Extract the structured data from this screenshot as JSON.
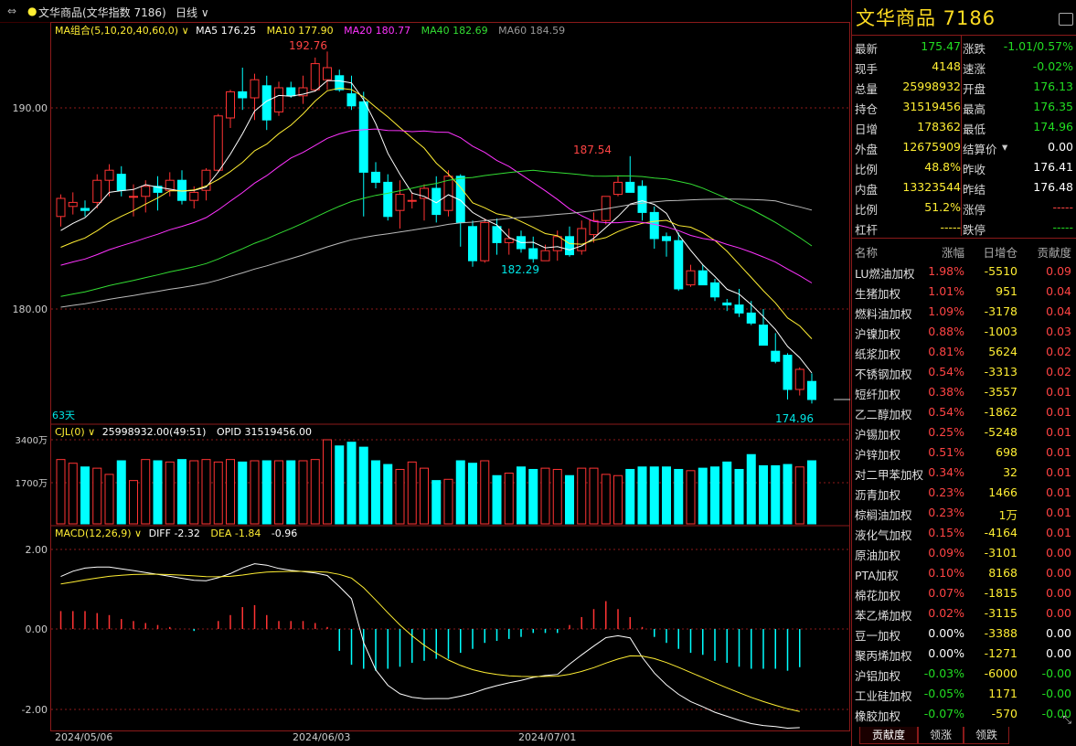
{
  "header": {
    "menu_icon": "link-icon",
    "instrument": "文华商品(文华指数 7186)",
    "period": "日线"
  },
  "main_chart": {
    "indicator_label": "MA组合(5,10,20,40,60,0)",
    "ma5": "MA5 176.25",
    "ma10": "MA10 177.90",
    "ma20": "MA20 180.77",
    "ma40": "MA40 182.69",
    "ma60": "MA60 184.59",
    "high_label": "192.76",
    "mid_high_label": "187.54",
    "mid_low_label": "182.29",
    "low_label": "174.96",
    "days_label": "63天",
    "y_ticks": [
      "190.00",
      "180.00"
    ],
    "colors": {
      "ma5": "#ffffff",
      "ma10": "#ffee33",
      "ma20": "#ff33ff",
      "ma40": "#33dd33",
      "ma60": "#bbbbbb",
      "up": "#ff3333",
      "down": "#00ffff"
    }
  },
  "volume_chart": {
    "label": "CJL(0)",
    "value": "25998932.00(49:51)",
    "opid": "OPID 31519456.00",
    "y_ticks": [
      "3400万",
      "1700万"
    ]
  },
  "macd_chart": {
    "label": "MACD(12,26,9)",
    "diff": "DIFF -2.32",
    "dea": "DEA -1.84",
    "macd": "-0.96",
    "y_ticks": [
      "2.00",
      "0.00",
      "-2.00"
    ]
  },
  "x_axis": [
    "2024/05/06",
    "2024/06/03",
    "2024/07/01"
  ],
  "chart_data": {
    "type": "candlestick",
    "dates": [
      "2024/05/06",
      "2024/06/03",
      "2024/07/01"
    ],
    "ohlc": [
      [
        184.6,
        185.7,
        184.1,
        185.5
      ],
      [
        185.1,
        185.8,
        184.7,
        185.3
      ],
      [
        185.0,
        185.4,
        184.6,
        184.9
      ],
      [
        185.3,
        186.7,
        185.0,
        186.4
      ],
      [
        186.4,
        187.2,
        185.6,
        186.9
      ],
      [
        186.7,
        187.1,
        185.6,
        185.9
      ],
      [
        185.6,
        186.2,
        184.6,
        185.6
      ],
      [
        185.6,
        186.4,
        184.8,
        186.1
      ],
      [
        186.1,
        186.6,
        184.9,
        185.8
      ],
      [
        185.9,
        186.8,
        185.6,
        186.4
      ],
      [
        186.4,
        186.9,
        185.2,
        185.4
      ],
      [
        185.4,
        186.1,
        185.0,
        185.8
      ],
      [
        185.9,
        187.0,
        185.4,
        186.9
      ],
      [
        186.9,
        189.7,
        186.8,
        189.6
      ],
      [
        189.5,
        190.9,
        189.0,
        190.8
      ],
      [
        190.8,
        192.0,
        189.9,
        190.5
      ],
      [
        190.5,
        191.7,
        189.4,
        191.4
      ],
      [
        191.1,
        191.6,
        188.9,
        189.4
      ],
      [
        189.8,
        191.3,
        189.6,
        191.0
      ],
      [
        191.0,
        191.3,
        190.5,
        190.6
      ],
      [
        190.6,
        191.6,
        190.2,
        191.0
      ],
      [
        190.9,
        192.5,
        190.8,
        192.2
      ],
      [
        191.4,
        192.8,
        190.9,
        192.0
      ],
      [
        191.6,
        191.9,
        190.8,
        190.9
      ],
      [
        190.7,
        191.6,
        189.9,
        190.1
      ],
      [
        190.3,
        190.8,
        184.6,
        186.8
      ],
      [
        186.8,
        187.3,
        186.0,
        186.3
      ],
      [
        186.3,
        186.7,
        184.4,
        184.6
      ],
      [
        184.9,
        186.4,
        184.0,
        185.7
      ],
      [
        185.4,
        185.8,
        185.0,
        185.4
      ],
      [
        185.5,
        186.2,
        184.4,
        186.0
      ],
      [
        186.0,
        186.6,
        184.3,
        184.7
      ],
      [
        184.9,
        186.9,
        184.6,
        186.6
      ],
      [
        186.6,
        186.7,
        183.1,
        184.3
      ],
      [
        184.1,
        184.4,
        182.1,
        182.4
      ],
      [
        182.4,
        184.5,
        182.3,
        184.3
      ],
      [
        184.1,
        184.5,
        182.7,
        183.3
      ],
      [
        183.3,
        184.0,
        182.7,
        183.5
      ],
      [
        183.6,
        183.9,
        182.8,
        183.0
      ],
      [
        183.0,
        183.6,
        182.3,
        182.5
      ],
      [
        182.4,
        183.2,
        182.4,
        182.9
      ],
      [
        182.9,
        183.9,
        182.4,
        183.6
      ],
      [
        183.6,
        184.1,
        182.6,
        182.7
      ],
      [
        182.9,
        184.4,
        182.7,
        184.0
      ],
      [
        183.7,
        184.8,
        183.3,
        184.4
      ],
      [
        184.4,
        185.6,
        184.2,
        185.6
      ],
      [
        185.7,
        186.6,
        185.6,
        186.3
      ],
      [
        186.3,
        187.6,
        186.1,
        185.8
      ],
      [
        186.1,
        186.4,
        184.4,
        184.8
      ],
      [
        184.8,
        185.1,
        183.0,
        183.5
      ],
      [
        183.6,
        183.8,
        182.6,
        183.4
      ],
      [
        183.4,
        183.8,
        180.9,
        181.0
      ],
      [
        181.2,
        182.2,
        181.1,
        181.9
      ],
      [
        181.9,
        182.2,
        181.2,
        181.2
      ],
      [
        181.3,
        181.5,
        180.4,
        180.6
      ],
      [
        180.3,
        180.5,
        179.9,
        180.2
      ],
      [
        180.2,
        181.0,
        179.6,
        179.8
      ],
      [
        179.8,
        180.4,
        179.2,
        179.3
      ],
      [
        179.2,
        180.0,
        178.2,
        178.2
      ],
      [
        177.9,
        178.8,
        177.3,
        177.4
      ],
      [
        177.7,
        177.8,
        175.5,
        176.0
      ],
      [
        176.0,
        177.1,
        175.7,
        177.0
      ],
      [
        176.4,
        176.8,
        175.3,
        175.5
      ]
    ],
    "volume_units": "万",
    "volume": [
      2600,
      2450,
      2300,
      2250,
      2000,
      2550,
      1750,
      2600,
      2550,
      2500,
      2600,
      2550,
      2600,
      2500,
      2600,
      2500,
      2550,
      2550,
      2550,
      2550,
      2550,
      2600,
      3400,
      3150,
      3300,
      3100,
      2550,
      2400,
      2200,
      2500,
      2250,
      1750,
      1800,
      2550,
      2450,
      2550,
      1950,
      2050,
      2300,
      2200,
      2250,
      2200,
      1950,
      2250,
      2250,
      2000,
      1950,
      2200,
      2300,
      2300,
      2300,
      2200,
      2150,
      2250,
      2300,
      2500,
      2200,
      2800,
      2350,
      2350,
      2400,
      2300,
      2550
    ],
    "macd_hist": [
      0.45,
      0.45,
      0.45,
      0.4,
      0.35,
      0.25,
      0.2,
      0.15,
      0.1,
      0.05,
      0.0,
      -0.05,
      0.0,
      0.2,
      0.35,
      0.55,
      0.6,
      0.35,
      0.2,
      0.2,
      0.2,
      0.15,
      0.05,
      -0.55,
      -0.9,
      -1.0,
      -1.05,
      -1.0,
      -0.95,
      -0.85,
      -0.8,
      -0.75,
      -0.75,
      -0.6,
      -0.5,
      -0.35,
      -0.3,
      -0.25,
      -0.2,
      -0.1,
      -0.1,
      -0.1,
      0.1,
      0.3,
      0.5,
      0.7,
      0.5,
      0.3,
      0.05,
      -0.2,
      -0.35,
      -0.5,
      -0.6,
      -0.65,
      -0.8,
      -0.85,
      -0.95,
      -1.0,
      -1.0,
      -1.0,
      -1.05,
      -0.96
    ]
  },
  "quote": {
    "title": "文华商品  7186",
    "rows": [
      {
        "l1": "最新",
        "v1": "175.47",
        "c1": "green",
        "l2": "涨跌",
        "v2": "-1.01/0.57%",
        "c2": "green"
      },
      {
        "l1": "现手",
        "v1": "4148",
        "c1": "yellow",
        "l2": "速涨",
        "v2": "-0.02%",
        "c2": "green"
      },
      {
        "l1": "总量",
        "v1": "25998932",
        "c1": "yellow",
        "l2": "开盘",
        "v2": "176.13",
        "c2": "green"
      },
      {
        "l1": "持仓",
        "v1": "31519456",
        "c1": "yellow",
        "l2": "最高",
        "v2": "176.35",
        "c2": "green"
      },
      {
        "l1": "日增",
        "v1": "178362",
        "c1": "yellow",
        "l2": "最低",
        "v2": "174.96",
        "c2": "green"
      },
      {
        "l1": "外盘",
        "v1": "12675909",
        "c1": "yellow",
        "l2": "结算价",
        "v2": "0.00",
        "c2": "white"
      },
      {
        "l1": "比例",
        "v1": "48.8%",
        "c1": "yellow",
        "l2": "昨收",
        "v2": "176.41",
        "c2": "white"
      },
      {
        "l1": "内盘",
        "v1": "13323544",
        "c1": "yellow",
        "l2": "昨结",
        "v2": "176.48",
        "c2": "white"
      },
      {
        "l1": "比例",
        "v1": "51.2%",
        "c1": "yellow",
        "l2": "涨停",
        "v2": "-----",
        "c2": "red"
      },
      {
        "l1": "杠杆",
        "v1": "-----",
        "c1": "yellow",
        "l2": "跌停",
        "v2": "-----",
        "c2": "green"
      }
    ]
  },
  "contrib": {
    "headers": [
      "名称",
      "涨幅",
      "日增仓",
      "贡献度"
    ],
    "rows": [
      {
        "n": "LU燃油加权",
        "p": "1.98%",
        "i": "-5510",
        "c": "0.09",
        "pc": "red",
        "cc": "red"
      },
      {
        "n": "生猪加权",
        "p": "1.01%",
        "i": "951",
        "c": "0.04",
        "pc": "red",
        "cc": "red"
      },
      {
        "n": "燃料油加权",
        "p": "1.09%",
        "i": "-3178",
        "c": "0.04",
        "pc": "red",
        "cc": "red"
      },
      {
        "n": "沪镍加权",
        "p": "0.88%",
        "i": "-1003",
        "c": "0.03",
        "pc": "red",
        "cc": "red"
      },
      {
        "n": "纸浆加权",
        "p": "0.81%",
        "i": "5624",
        "c": "0.02",
        "pc": "red",
        "cc": "red"
      },
      {
        "n": "不锈钢加权",
        "p": "0.54%",
        "i": "-3313",
        "c": "0.02",
        "pc": "red",
        "cc": "red"
      },
      {
        "n": "短纤加权",
        "p": "0.38%",
        "i": "-3557",
        "c": "0.01",
        "pc": "red",
        "cc": "red"
      },
      {
        "n": "乙二醇加权",
        "p": "0.54%",
        "i": "-1862",
        "c": "0.01",
        "pc": "red",
        "cc": "red"
      },
      {
        "n": "沪锡加权",
        "p": "0.25%",
        "i": "-5248",
        "c": "0.01",
        "pc": "red",
        "cc": "red"
      },
      {
        "n": "沪锌加权",
        "p": "0.51%",
        "i": "698",
        "c": "0.01",
        "pc": "red",
        "cc": "red"
      },
      {
        "n": "对二甲苯加权",
        "p": "0.34%",
        "i": "32",
        "c": "0.01",
        "pc": "red",
        "cc": "red"
      },
      {
        "n": "沥青加权",
        "p": "0.23%",
        "i": "1466",
        "c": "0.01",
        "pc": "red",
        "cc": "red"
      },
      {
        "n": "棕榈油加权",
        "p": "0.23%",
        "i": "1万",
        "c": "0.01",
        "pc": "red",
        "cc": "red"
      },
      {
        "n": "液化气加权",
        "p": "0.15%",
        "i": "-4164",
        "c": "0.01",
        "pc": "red",
        "cc": "red"
      },
      {
        "n": "原油加权",
        "p": "0.09%",
        "i": "-3101",
        "c": "0.00",
        "pc": "red",
        "cc": "red"
      },
      {
        "n": "PTA加权",
        "p": "0.10%",
        "i": "8168",
        "c": "0.00",
        "pc": "red",
        "cc": "red"
      },
      {
        "n": "棉花加权",
        "p": "0.07%",
        "i": "-1815",
        "c": "0.00",
        "pc": "red",
        "cc": "red"
      },
      {
        "n": "苯乙烯加权",
        "p": "0.02%",
        "i": "-3115",
        "c": "0.00",
        "pc": "red",
        "cc": "red"
      },
      {
        "n": "豆一加权",
        "p": "0.00%",
        "i": "-3388",
        "c": "0.00",
        "pc": "white",
        "cc": "white"
      },
      {
        "n": "聚丙烯加权",
        "p": "0.00%",
        "i": "-1271",
        "c": "0.00",
        "pc": "white",
        "cc": "white"
      },
      {
        "n": "沪铝加权",
        "p": "-0.03%",
        "i": "-6000",
        "c": "-0.00",
        "pc": "green",
        "cc": "green"
      },
      {
        "n": "工业硅加权",
        "p": "-0.05%",
        "i": "1171",
        "c": "-0.00",
        "pc": "green",
        "cc": "green"
      },
      {
        "n": "橡胶加权",
        "p": "-0.07%",
        "i": "-570",
        "c": "-0.00",
        "pc": "green",
        "cc": "green"
      }
    ]
  },
  "tabs": [
    "贡献度",
    "领涨",
    "领跌"
  ]
}
